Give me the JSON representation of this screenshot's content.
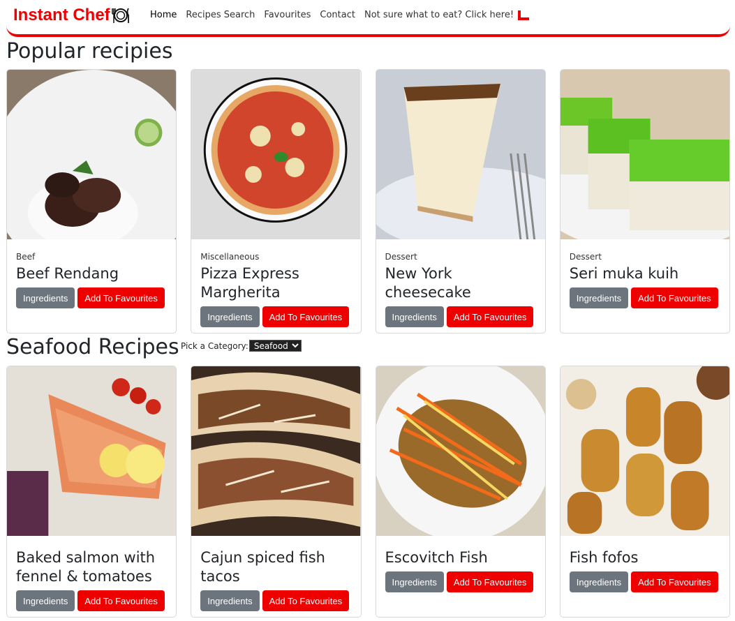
{
  "brand": {
    "name": "Instant Chef"
  },
  "nav": {
    "home": "Home",
    "search": "Recipes Search",
    "favourites": "Favourites",
    "contact": "Contact",
    "random": "Not sure what to eat? Click here!"
  },
  "popular": {
    "heading": "Popular recipies",
    "cards": [
      {
        "category": "Beef",
        "title": "Beef Rendang"
      },
      {
        "category": "Miscellaneous",
        "title": "Pizza Express Margherita"
      },
      {
        "category": "Dessert",
        "title": "New York cheesecake"
      },
      {
        "category": "Dessert",
        "title": "Seri muka kuih"
      }
    ]
  },
  "seafood": {
    "heading": "Seafood Recipes",
    "picker_label": "Pick a Category:",
    "picker_value": "Seafood",
    "cards": [
      {
        "title": "Baked salmon with fennel & tomatoes"
      },
      {
        "title": "Cajun spiced fish tacos"
      },
      {
        "title": "Escovitch Fish"
      },
      {
        "title": "Fish fofos"
      }
    ]
  },
  "buttons": {
    "ingredients": "Ingredients",
    "add": "Add To Favourites"
  },
  "colors": {
    "accent": "#ee0000",
    "secondary": "#6c757d"
  }
}
